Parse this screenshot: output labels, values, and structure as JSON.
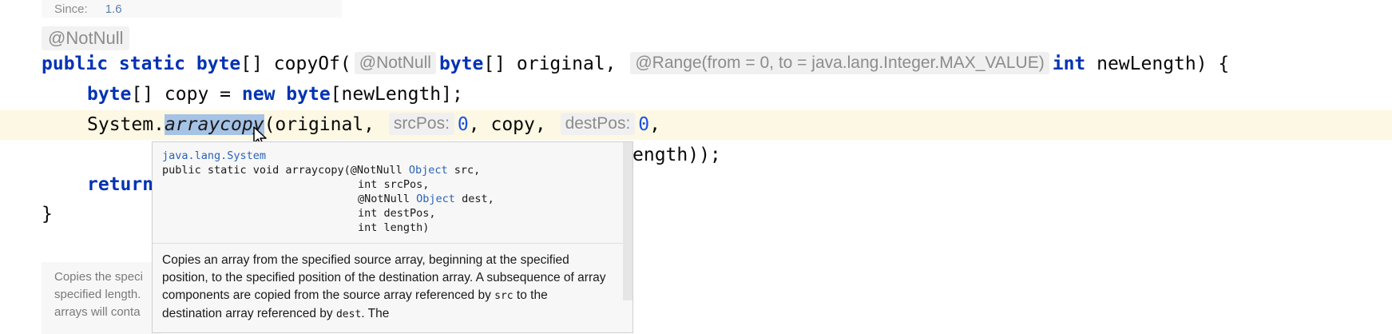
{
  "since": {
    "label": "Since:",
    "value": "1.6"
  },
  "annotation": "@NotNull",
  "code": {
    "l1": {
      "kw1": "public static",
      "type1": "byte",
      "t1": "[] copyOf(",
      "hint1": "@NotNull",
      "type2": "byte",
      "t2": "[] original,",
      "hint2": "@Range(from = 0, to = java.lang.Integer.MAX_VALUE)",
      "type3": "int",
      "t3": " newLength) {"
    },
    "l2": {
      "type": "byte",
      "t1": "[] copy = ",
      "kw": "new",
      "t2": " ",
      "type2": "byte",
      "t3": "[newLength];"
    },
    "l3": {
      "t1": "System.",
      "sel": "arraycopy",
      "t2": "(original,",
      "hint1": "srcPos:",
      "n1": "0",
      "t3": ", copy,",
      "hint2": "destPos:",
      "n2": "0",
      "t4": ","
    },
    "l4": {
      "t1": "ength));"
    },
    "l5": {
      "kw": "return"
    },
    "l6": {
      "t1": "}"
    }
  },
  "popup": {
    "class_name": "java.lang.System",
    "sig1a": "public static void arraycopy(@NotNull ",
    "sig1_type": "Object",
    "sig1b": " src,",
    "sig2": "int srcPos,",
    "sig3a": "@NotNull ",
    "sig3_type": "Object",
    "sig3b": " dest,",
    "sig4": "int destPos,",
    "sig5": "int length)",
    "desc1": "Copies an array from the specified source array, beginning at the specified position, to the specified position of the destination array. A subsequence of array components are copied from the source array referenced by ",
    "code_src": "src",
    "desc2": " to the destination array referenced by ",
    "code_dest": "dest",
    "desc3": ". The"
  },
  "doc_panel": {
    "line1": "Copies the speci",
    "line2": "specified length.",
    "line3": "arrays will conta"
  }
}
